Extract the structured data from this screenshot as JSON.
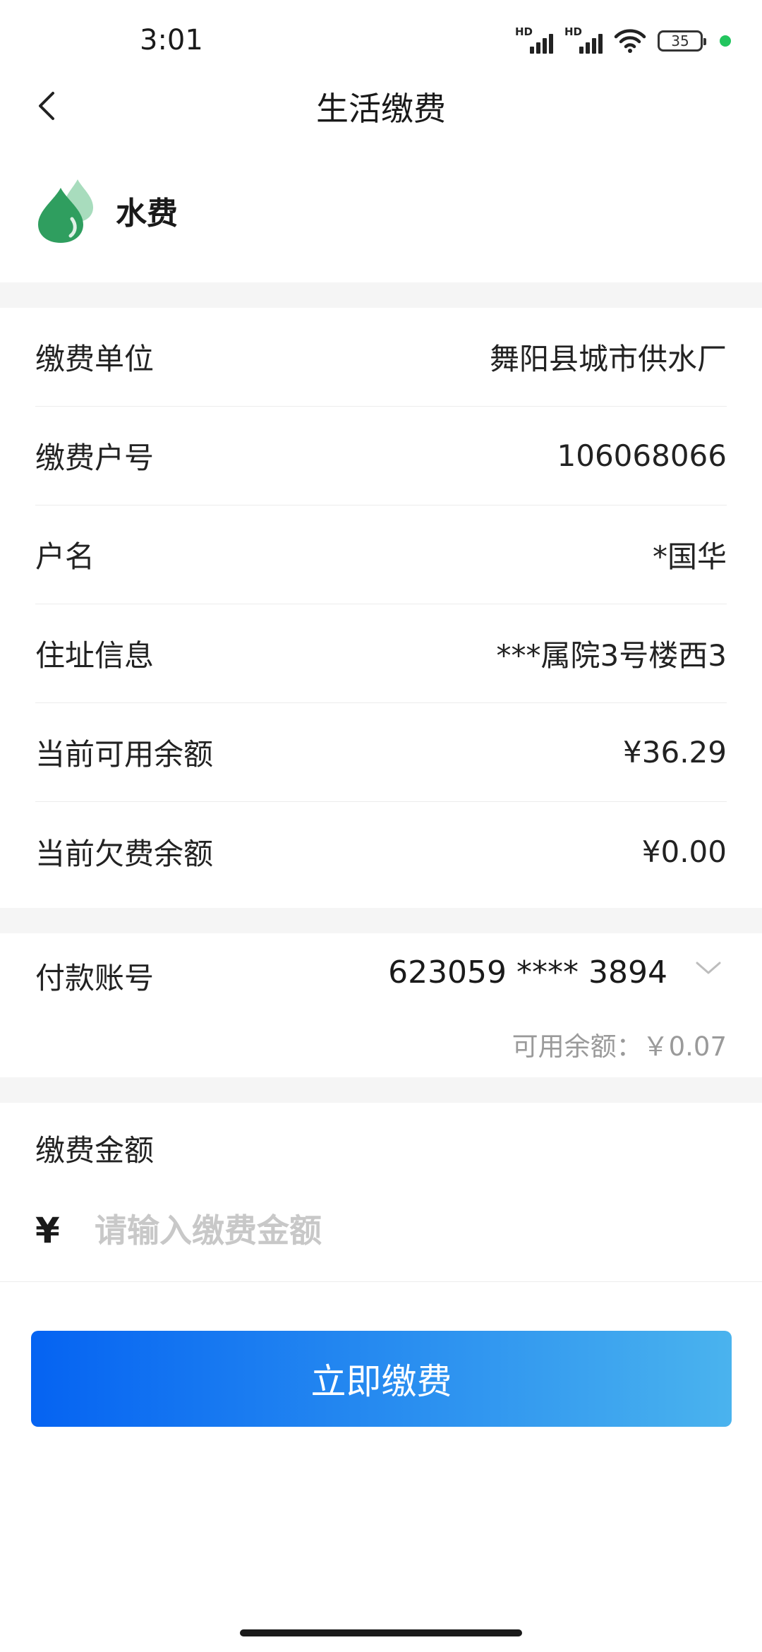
{
  "status_bar": {
    "time": "3:01",
    "signal_1_label": "HD",
    "signal_2_label": "HD",
    "battery_level": "35"
  },
  "nav": {
    "title": "生活缴费"
  },
  "service": {
    "name": "水费",
    "icon": "water-drop-icon",
    "icon_colors": {
      "primary": "#2f9e5f",
      "secondary": "#a8dcbd"
    }
  },
  "info": {
    "rows": [
      {
        "label": "缴费单位",
        "value": "舞阳县城市供水厂"
      },
      {
        "label": "缴费户号",
        "value": "106068066"
      },
      {
        "label": "户名",
        "value": "*国华"
      },
      {
        "label": "住址信息",
        "value": "***属院3号楼西3"
      },
      {
        "label": "当前可用余额",
        "value": "¥36.29"
      },
      {
        "label": "当前欠费余额",
        "value": "¥0.00"
      }
    ]
  },
  "account": {
    "label": "付款账号",
    "number": "623059 **** 3894",
    "balance_note": "可用余额：￥0.07"
  },
  "amount": {
    "label": "缴费金额",
    "currency_symbol": "¥",
    "placeholder": "请输入缴费金额",
    "value": ""
  },
  "pay_button": {
    "label": "立即缴费",
    "gradient_start": "#0563f2",
    "gradient_end": "#4ab3ee"
  }
}
